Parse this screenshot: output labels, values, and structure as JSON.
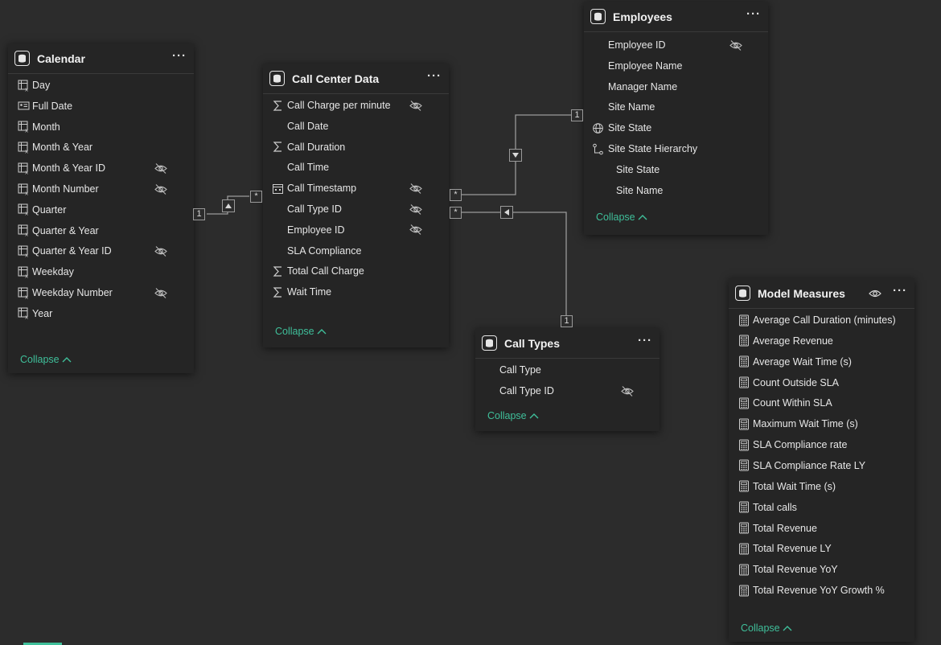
{
  "tables": {
    "calendar": {
      "title": "Calendar",
      "fields": [
        "Day",
        "Full Date",
        "Month",
        "Month & Year",
        "Month & Year ID",
        "Month Number",
        "Quarter",
        "Quarter & Year",
        "Quarter & Year ID",
        "Weekday",
        "Weekday Number",
        "Year"
      ],
      "field_icons": [
        "calc-column-icon",
        "id-card-icon",
        "calc-column-icon",
        "calc-column-icon",
        "calc-column-icon",
        "calc-column-icon",
        "calc-column-icon",
        "calc-column-icon",
        "calc-column-icon",
        "calc-column-icon",
        "calc-column-icon",
        "calc-column-icon"
      ],
      "hidden": [
        false,
        false,
        false,
        false,
        true,
        true,
        false,
        false,
        true,
        false,
        true,
        false
      ],
      "collapse_label": "Collapse"
    },
    "call_center": {
      "title": "Call Center Data",
      "fields": [
        "Call Charge per minute",
        "Call Date",
        "Call Duration",
        "Call Time",
        "Call Timestamp",
        "Call Type ID",
        "Employee ID",
        "SLA Compliance",
        "Total Call Charge",
        "Wait Time"
      ],
      "field_icons": [
        "sigma-icon",
        "",
        "sigma-icon",
        "",
        "calendar-icon",
        "",
        "",
        "",
        "sigma-icon",
        "sigma-icon"
      ],
      "hidden": [
        true,
        false,
        false,
        false,
        true,
        true,
        true,
        false,
        false,
        false
      ],
      "collapse_label": "Collapse"
    },
    "employees": {
      "title": "Employees",
      "fields": [
        "Employee ID",
        "Employee Name",
        "Manager Name",
        "Site Name",
        "Site State",
        "Site State Hierarchy",
        "Site State",
        "Site Name"
      ],
      "field_icons": [
        "",
        "",
        "",
        "",
        "globe-icon",
        "hierarchy-icon",
        "",
        ""
      ],
      "indented": [
        false,
        false,
        false,
        false,
        false,
        false,
        true,
        true
      ],
      "hidden": [
        true,
        false,
        false,
        false,
        false,
        false,
        false,
        false
      ],
      "collapse_label": "Collapse"
    },
    "call_types": {
      "title": "Call Types",
      "fields": [
        "Call Type",
        "Call Type ID"
      ],
      "hidden": [
        false,
        true
      ],
      "collapse_label": "Collapse"
    },
    "model_measures": {
      "title": "Model Measures",
      "fields": [
        "Average Call Duration (minutes)",
        "Average Revenue",
        "Average Wait Time (s)",
        "Count Outside SLA",
        "Count Within SLA",
        "Maximum Wait Time (s)",
        "SLA Compliance rate",
        "SLA Compliance Rate LY",
        "Total Wait Time (s)",
        "Total calls",
        "Total Revenue",
        "Total Revenue LY",
        "Total Revenue YoY",
        "Total Revenue YoY Growth %"
      ],
      "field_icon": "measure-calculator-icon",
      "collapse_label": "Collapse"
    }
  },
  "relationships": {
    "one": "1",
    "many": "*"
  },
  "colors": {
    "canvas": "#2c2c2c",
    "card": "#252525",
    "accent": "#3fbf9a",
    "text": "#e6e6e6"
  }
}
